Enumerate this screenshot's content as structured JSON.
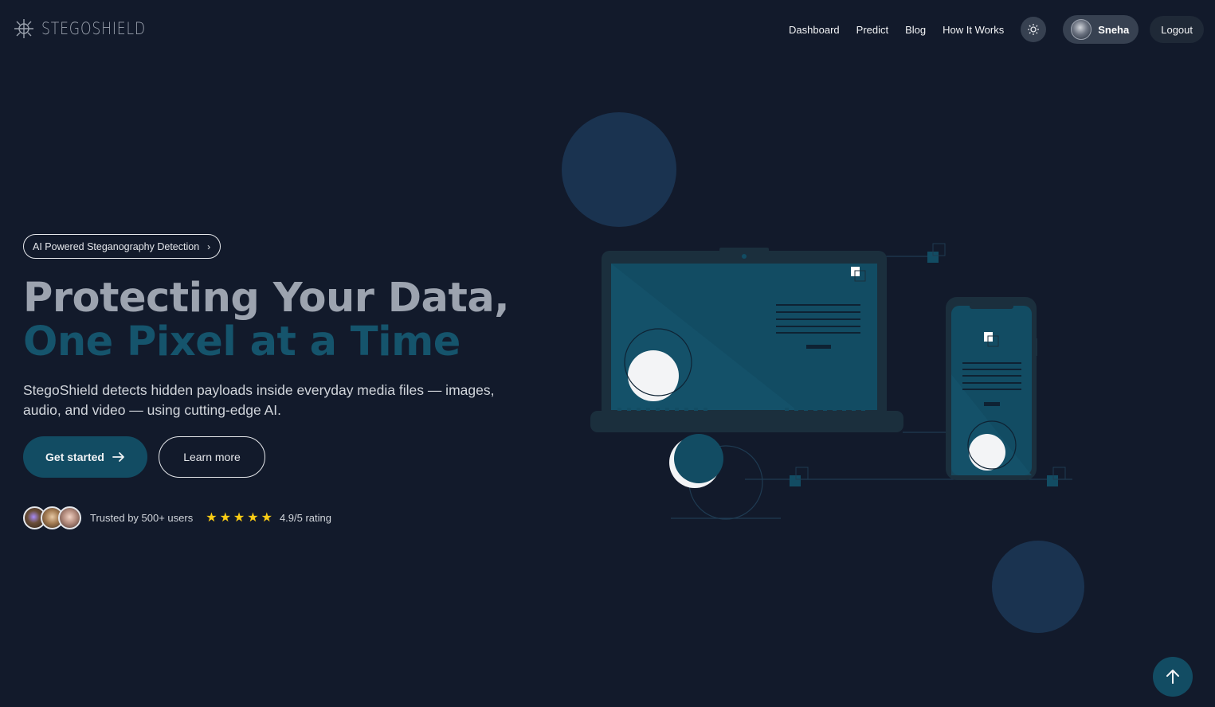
{
  "brand": {
    "name": "STEGOSHIELD"
  },
  "nav": {
    "links": [
      "Dashboard",
      "Predict",
      "Blog",
      "How It Works"
    ],
    "theme_icon": "sun-icon",
    "user": {
      "name": "Sneha"
    },
    "logout": "Logout"
  },
  "hero": {
    "badge": "AI Powered Steganography Detection",
    "headline_line1": "Protecting Your Data,",
    "headline_line2": "One Pixel at a Time",
    "lead": "StegoShield detects hidden payloads inside everyday media files — images, audio, and video — using cutting-edge AI.",
    "primary_cta": "Get started",
    "secondary_cta": "Learn more",
    "trust_text": "Trusted by 500+ users",
    "stars": 5,
    "rating_text": "4.9/5 rating"
  },
  "colors": {
    "background": "#121a2b",
    "accent": "#15546c",
    "button": "#124c63",
    "star": "#facc15"
  },
  "scroll_top_icon": "arrow-up-icon"
}
